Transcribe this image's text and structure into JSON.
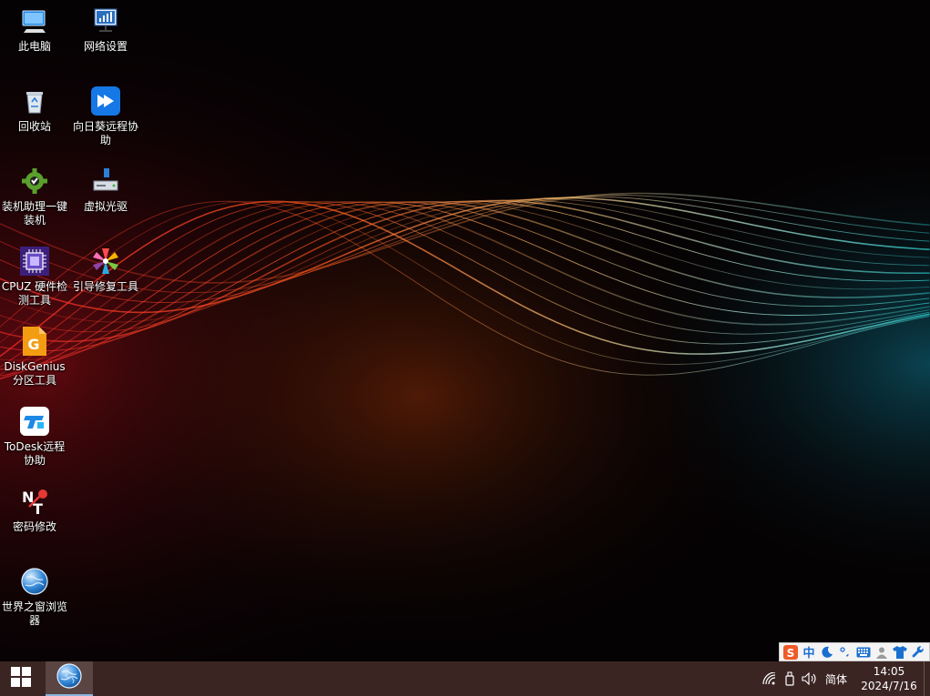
{
  "desktop": {
    "icons": [
      {
        "label": "此电脑",
        "icon": "computer-icon"
      },
      {
        "label": "网络设置",
        "icon": "network-settings-icon"
      },
      {
        "label": "回收站",
        "icon": "recycle-bin-icon"
      },
      {
        "label": "向日葵远程协助",
        "icon": "sunlogin-icon"
      },
      {
        "label": "装机助理一键装机",
        "icon": "installer-gear-icon"
      },
      {
        "label": "虚拟光驱",
        "icon": "virtual-drive-icon"
      },
      {
        "label": "CPUZ 硬件检测工具",
        "icon": "cpu-chip-icon"
      },
      {
        "label": "引导修复工具",
        "icon": "boot-repair-icon"
      },
      {
        "label": "DiskGenius分区工具",
        "icon": "diskgenius-icon"
      },
      {
        "label": "ToDesk远程协助",
        "icon": "todesk-icon"
      },
      {
        "label": "密码修改",
        "icon": "password-key-icon"
      },
      {
        "label": "世界之窗浏览器",
        "icon": "browser-globe-icon"
      }
    ]
  },
  "ime_toolbar": {
    "mode_label": "中",
    "icons": [
      "sogou-logo-icon",
      "chinese-mode-icon",
      "moon-icon",
      "punctuation-icon",
      "keyboard-icon",
      "user-icon",
      "shirt-icon",
      "wrench-icon"
    ]
  },
  "taskbar": {
    "start_icon": "windows-logo-icon",
    "pinned": [
      {
        "name": "世界之窗浏览器",
        "icon": "browser-globe-icon"
      }
    ],
    "tray": {
      "icons": [
        "network-icon",
        "usb-drive-icon",
        "volume-icon"
      ],
      "input_language": "简体",
      "time": "14:05",
      "date": "2024/7/16"
    }
  },
  "colors": {
    "taskbar_bg": "#3b2523",
    "desktop_bg": "#050203",
    "wave_red": "#ff3b1a",
    "wave_orange": "#ffb347",
    "wave_cyan": "#3fe0d0"
  }
}
